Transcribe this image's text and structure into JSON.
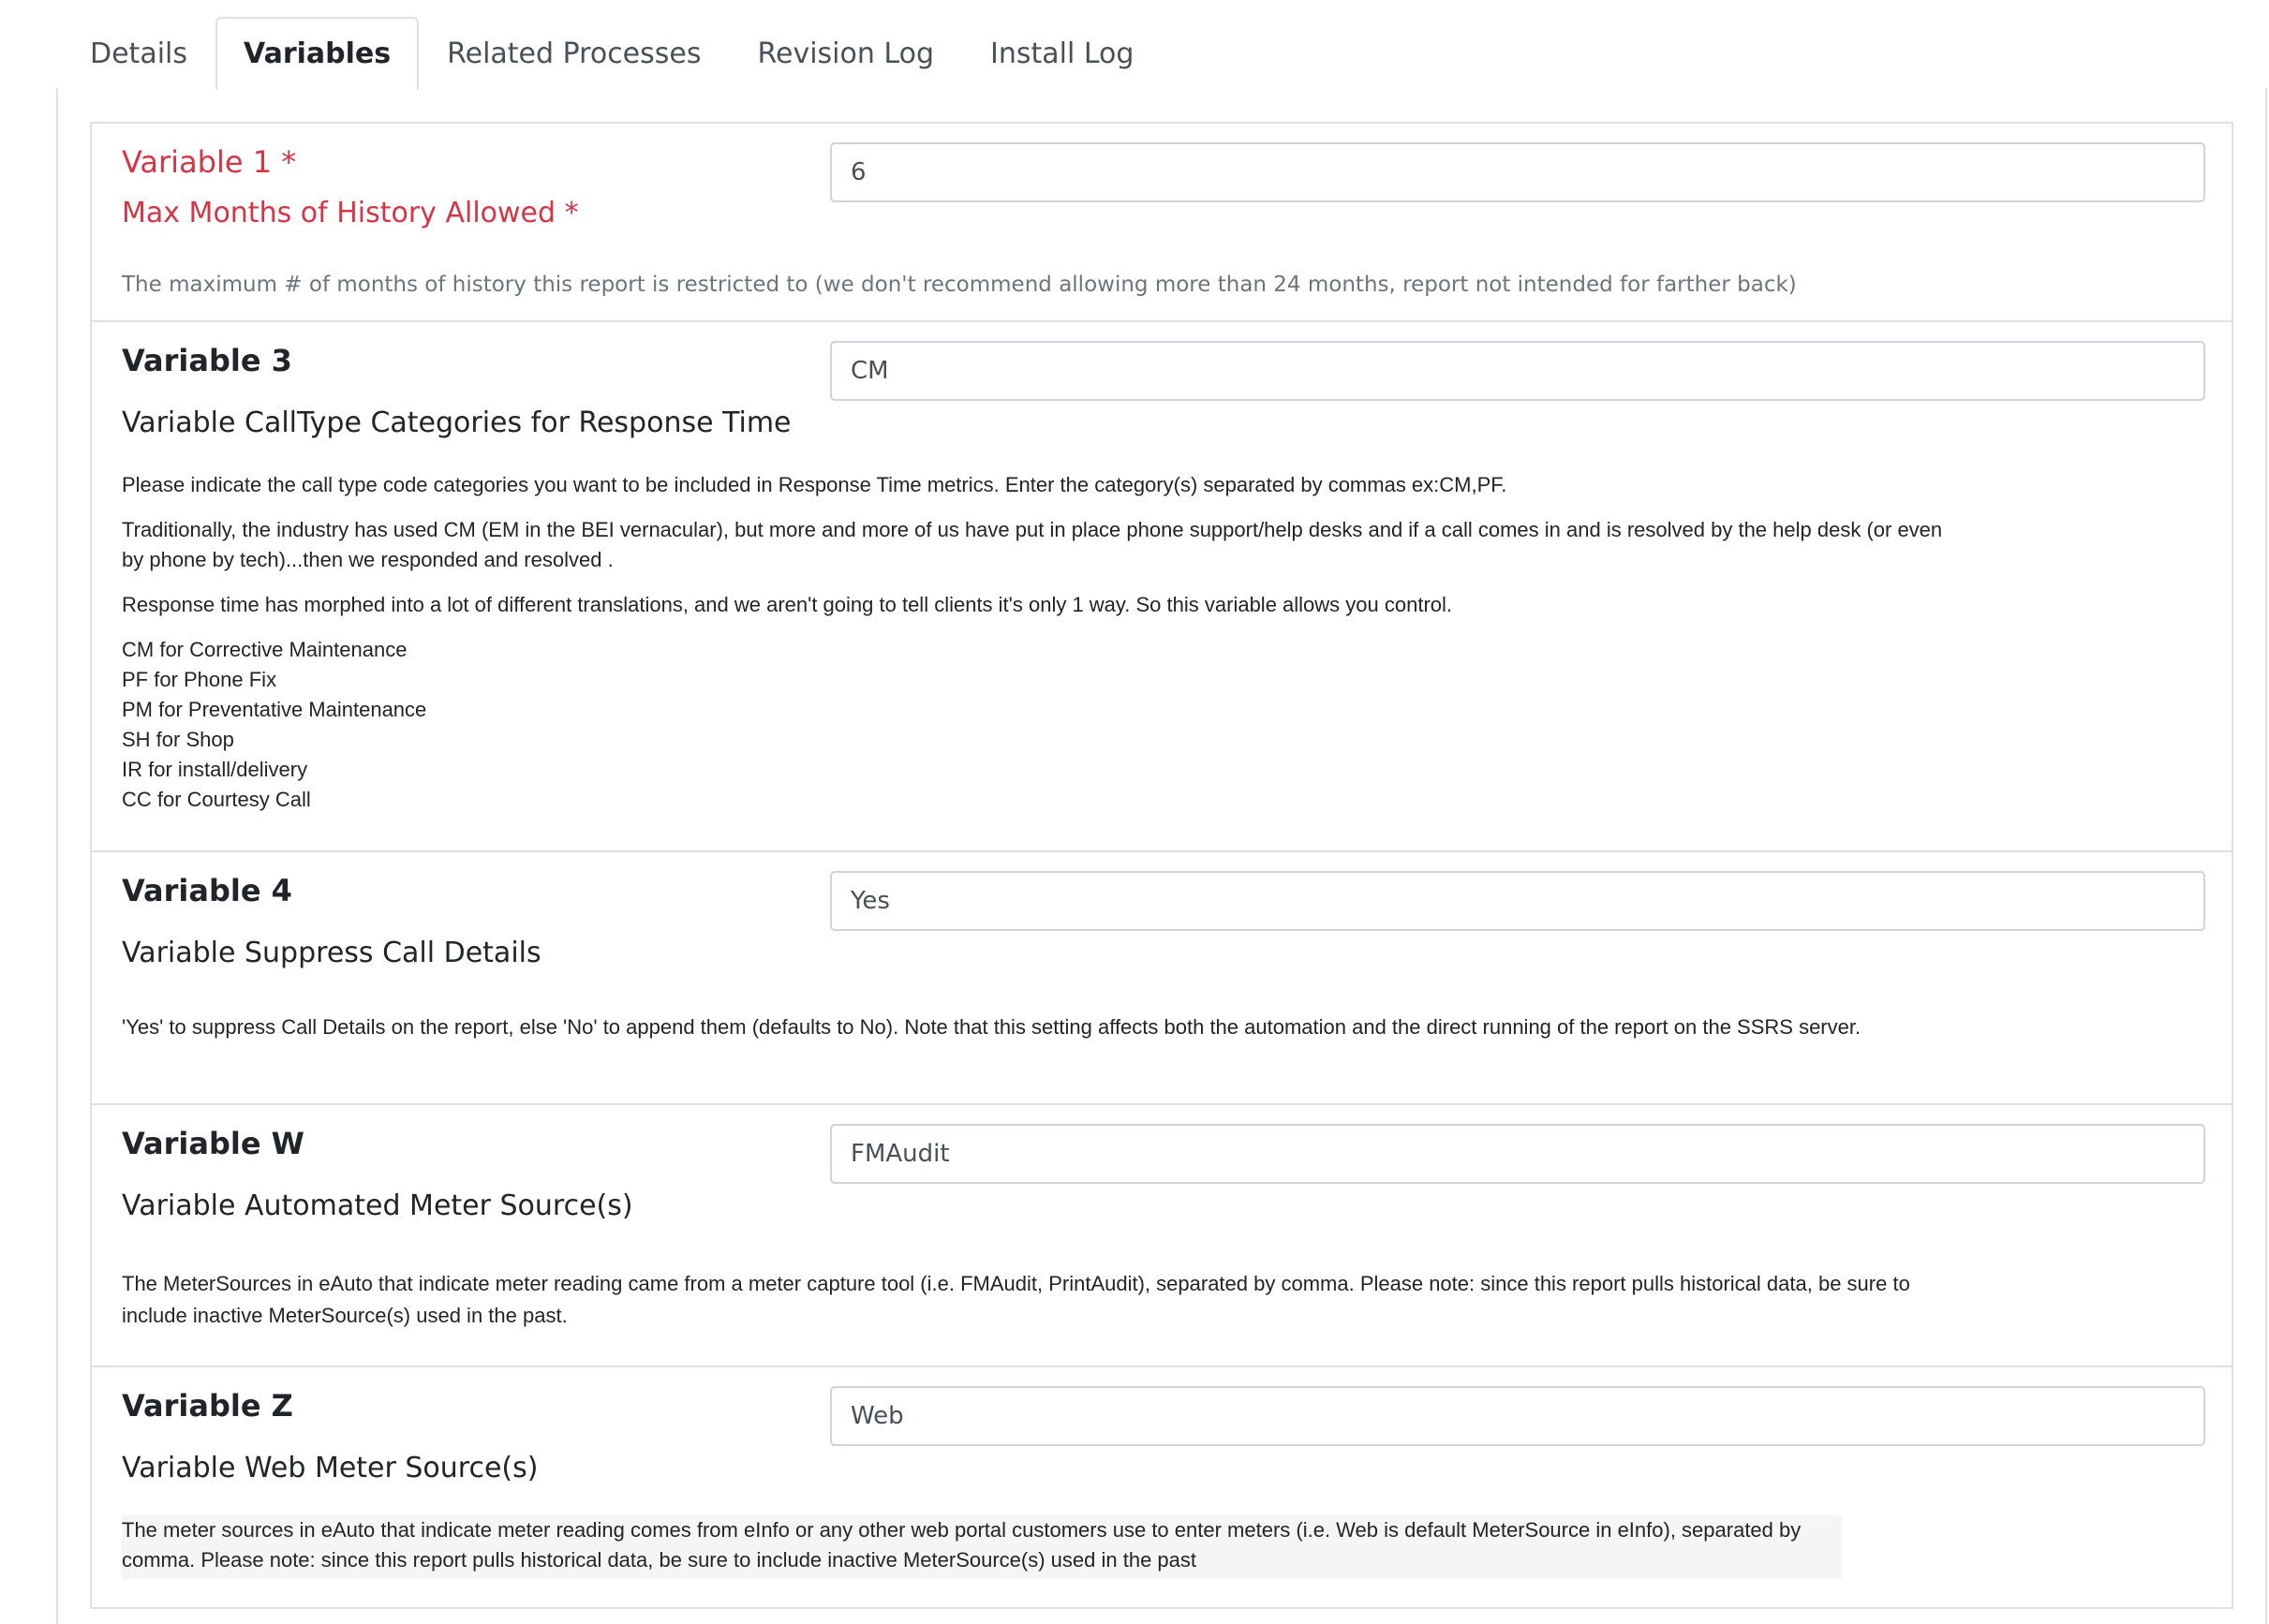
{
  "tabs": [
    {
      "label": "Details"
    },
    {
      "label": "Variables"
    },
    {
      "label": "Related Processes"
    },
    {
      "label": "Revision Log"
    },
    {
      "label": "Install Log"
    }
  ],
  "variables": [
    {
      "title": "Variable 1 *",
      "subtitle": "Max Months of History Allowed *",
      "value": "6",
      "help": "The maximum # of months of history this report is restricted to (we don't recommend allowing more than 24 months, report not intended for farther back)"
    },
    {
      "title": "Variable 3",
      "subtitle": "Variable CallType Categories for Response Time",
      "value": "CM",
      "help_p1": "Please indicate the call type code categories you want to be included in Response Time metrics.  Enter the category(s) separated by commas ex:CM,PF.",
      "help_p2": "Traditionally, the industry has used CM (EM in the BEI vernacular), but more and more of us have put in place phone support/help desks and if a call comes in and is resolved by the help desk (or even by phone by tech)...then we responded and resolved .",
      "help_p3": "Response time has morphed into a lot of different translations, and we aren't going to tell clients it's only 1 way. So this variable allows you control.",
      "codes": [
        "CM for Corrective Maintenance",
        "PF for Phone Fix",
        "PM for Preventative Maintenance",
        "SH for Shop",
        "IR for install/delivery",
        "CC for Courtesy Call"
      ]
    },
    {
      "title": "Variable 4",
      "subtitle": "Variable Suppress Call Details",
      "value": "Yes",
      "help": "'Yes' to suppress Call Details on the report, else 'No' to append them (defaults to No). Note that this setting affects both the automation and the direct running of the report on the SSRS server."
    },
    {
      "title": "Variable W",
      "subtitle": "Variable Automated Meter Source(s)",
      "value": "FMAudit",
      "help": "The MeterSources in eAuto that indicate meter reading came from a meter capture tool (i.e. FMAudit, PrintAudit), separated by comma. Please note: since this report pulls historical data, be sure to include inactive MeterSource(s) used in the past."
    },
    {
      "title": "Variable Z",
      "subtitle": "Variable Web Meter Source(s)",
      "value": "Web",
      "help": "The meter sources in eAuto that indicate meter reading comes from eInfo or any other web portal customers use to enter meters (i.e. Web is default MeterSource in eInfo), separated by comma. Please note: since this report pulls historical data, be sure to include inactive MeterSource(s) used in the past"
    }
  ]
}
